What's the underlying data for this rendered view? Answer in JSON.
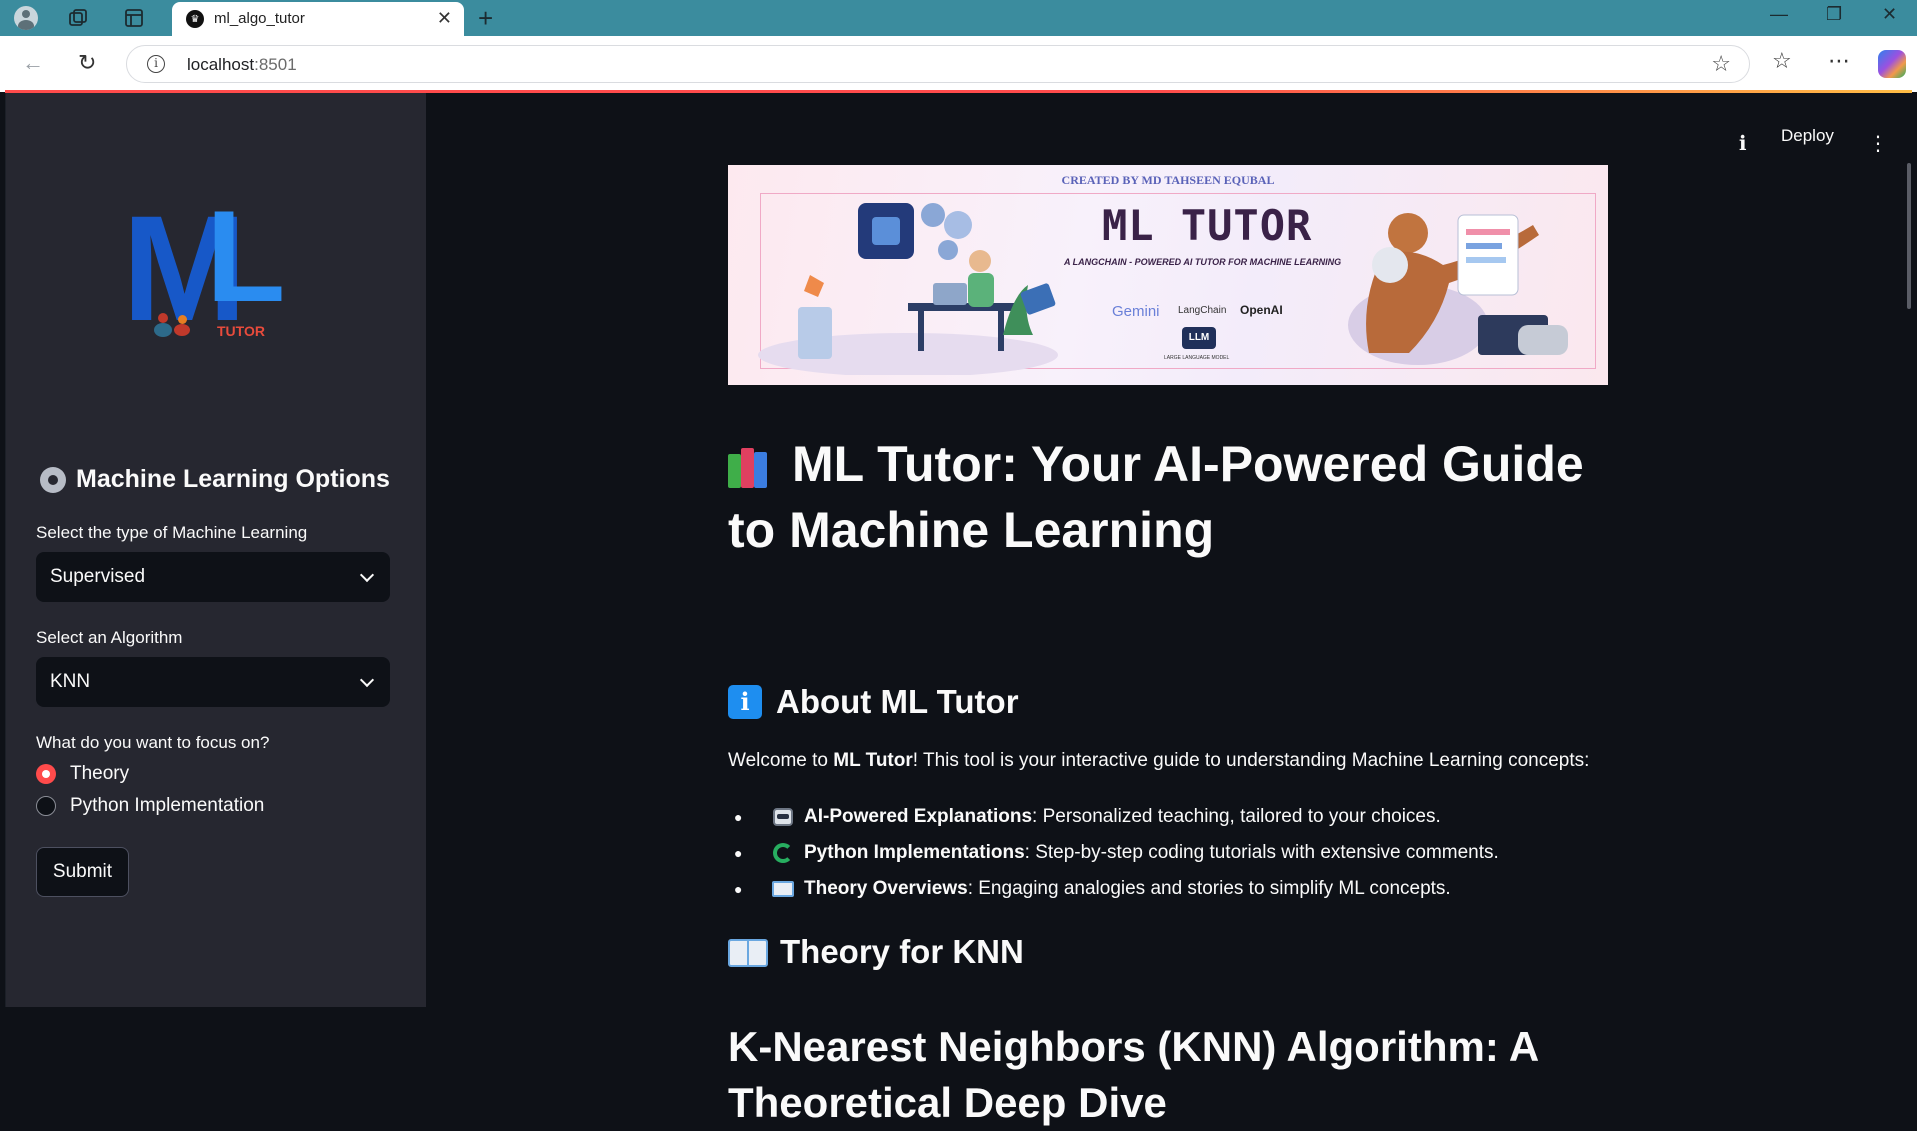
{
  "browser": {
    "tab_title": "ml_algo_tutor",
    "url_host": "localhost",
    "url_port": ":8501"
  },
  "sidebar": {
    "logo_text_m": "M",
    "logo_text_l": "L",
    "logo_text_tutor": "TUTOR",
    "header": "Machine Learning Options",
    "ml_type_label": "Select the type of Machine Learning",
    "ml_type_value": "Supervised",
    "algorithm_label": "Select an Algorithm",
    "algorithm_value": "KNN",
    "focus_label": "What do you want to focus on?",
    "focus_options": [
      "Theory",
      "Python Implementation"
    ],
    "focus_selected": "Theory",
    "submit_label": "Submit"
  },
  "header": {
    "deploy_label": "Deploy"
  },
  "banner": {
    "credit": "CREATED BY MD TAHSEEN EQUBAL",
    "title": "ML TUTOR",
    "subtitle": "A LANGCHAIN - POWERED AI TUTOR FOR MACHINE LEARNING",
    "logo_gemini": "Gemini",
    "logo_langchain": "LangChain",
    "logo_openai": "OpenAI",
    "logo_llm": "LLM",
    "logo_llm_caption": "LARGE LANGUAGE MODEL"
  },
  "main": {
    "title": "ML Tutor: Your AI-Powered Guide to Machine Learning",
    "about_heading": "About ML Tutor",
    "welcome_prefix": "Welcome to ",
    "welcome_bold": "ML Tutor",
    "welcome_suffix": "! This tool is your interactive guide to understanding Machine Learning concepts:",
    "features": [
      {
        "bold": "AI-Powered Explanations",
        "text": ": Personalized teaching, tailored to your choices."
      },
      {
        "bold": "Python Implementations",
        "text": ": Step-by-step coding tutorials with extensive comments."
      },
      {
        "bold": "Theory Overviews",
        "text": ": Engaging analogies and stories to simplify ML concepts."
      }
    ],
    "theory_heading": "Theory for KNN",
    "content_title": "K-Nearest Neighbors (KNN) Algorithm: A Theoretical Deep Dive"
  }
}
